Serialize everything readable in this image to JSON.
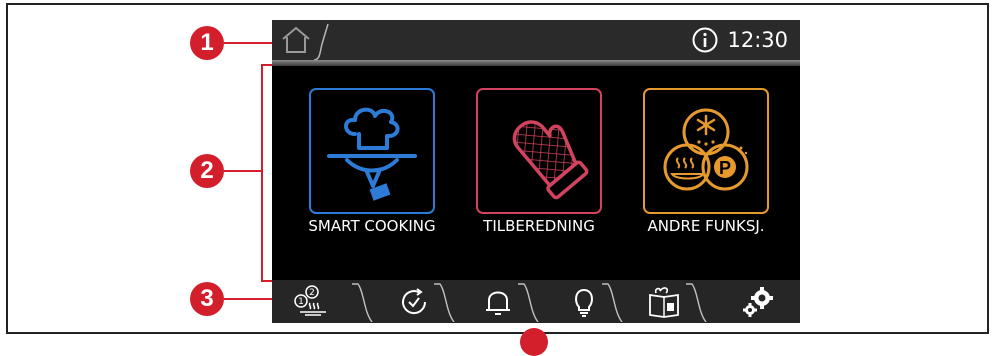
{
  "callouts": {
    "c1": "1",
    "c2": "2",
    "c3": "3"
  },
  "header": {
    "time": "12:30"
  },
  "tiles": [
    {
      "label": "SMART COOKING",
      "color": "#2c7bd6"
    },
    {
      "label": "TILBEREDNING",
      "color": "#d1435e"
    },
    {
      "label": "ANDRE FUNKSJ.",
      "color": "#e69a2e"
    }
  ],
  "icons": {
    "home": "home-icon",
    "info": "info-icon",
    "tabs": [
      "recipe-steps-icon",
      "timer-icon",
      "bell-icon",
      "light-bulb-icon",
      "cookbook-icon",
      "settings-icon"
    ]
  },
  "colors": {
    "callout": "#d31f2b",
    "screen": "#000000",
    "bar": "#2a2a2a"
  }
}
